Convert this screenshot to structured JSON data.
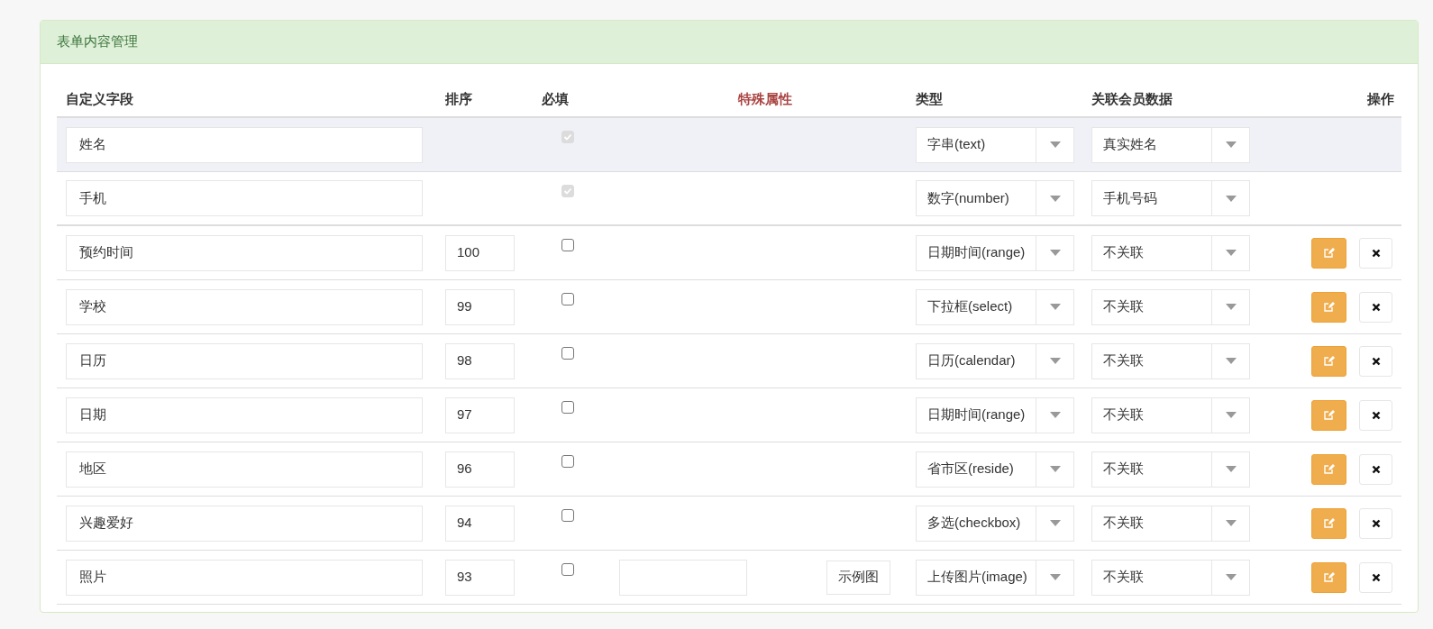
{
  "panel": {
    "title": "表单内容管理"
  },
  "table": {
    "columns": [
      {
        "label": "自定义字段",
        "kind": "plain"
      },
      {
        "label": "排序",
        "kind": "plain"
      },
      {
        "label": "必填",
        "kind": "plain"
      },
      {
        "label": "特殊属性",
        "kind": "accent"
      },
      {
        "label": "类型",
        "kind": "plain"
      },
      {
        "label": "关联会员数据",
        "kind": "plain"
      },
      {
        "label": "操作",
        "kind": "plain"
      }
    ],
    "rows": [
      {
        "kind": "fixed",
        "highlighted": true,
        "name": "姓名",
        "required": {
          "checked": true,
          "disabled": true
        },
        "type": "字串(text)",
        "member": "真实姓名"
      },
      {
        "kind": "fixed",
        "highlighted": false,
        "name": "手机",
        "required": {
          "checked": true,
          "disabled": true
        },
        "type": "数字(number)",
        "member": "手机号码"
      },
      {
        "kind": "custom",
        "highlighted": false,
        "name": "预约时间",
        "sort": "100",
        "required": {
          "checked": false,
          "disabled": false
        },
        "type": "日期时间(range)",
        "member": "不关联"
      },
      {
        "kind": "custom",
        "highlighted": false,
        "name": "学校",
        "sort": "99",
        "required": {
          "checked": false,
          "disabled": false
        },
        "type": "下拉框(select)",
        "member": "不关联"
      },
      {
        "kind": "custom",
        "highlighted": false,
        "name": "日历",
        "sort": "98",
        "required": {
          "checked": false,
          "disabled": false
        },
        "type": "日历(calendar)",
        "member": "不关联"
      },
      {
        "kind": "custom",
        "highlighted": false,
        "name": "日期",
        "sort": "97",
        "required": {
          "checked": false,
          "disabled": false
        },
        "type": "日期时间(range)",
        "member": "不关联"
      },
      {
        "kind": "custom",
        "highlighted": false,
        "name": "地区",
        "sort": "96",
        "required": {
          "checked": false,
          "disabled": false
        },
        "type": "省市区(reside)",
        "member": "不关联"
      },
      {
        "kind": "custom",
        "highlighted": false,
        "name": "兴趣爱好",
        "sort": "94",
        "required": {
          "checked": false,
          "disabled": false
        },
        "type": "多选(checkbox)",
        "member": "不关联"
      },
      {
        "kind": "custom",
        "highlighted": false,
        "name": "照片",
        "sort": "93",
        "required": {
          "checked": false,
          "disabled": false
        },
        "special": {
          "sample_button": "示例图"
        },
        "type": "上传图片(image)",
        "member": "不关联"
      }
    ]
  }
}
